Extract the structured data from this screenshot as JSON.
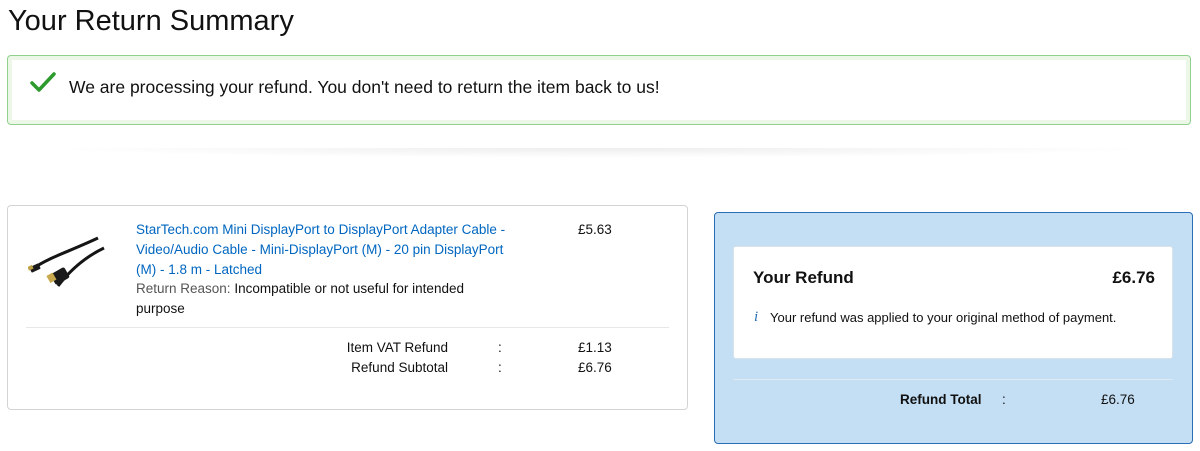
{
  "page": {
    "title": "Your Return Summary"
  },
  "alert": {
    "icon": "check-icon",
    "color": "#2c9a2c",
    "message": "We are processing your refund. You don't need to return the item back to us!"
  },
  "item": {
    "image_icon": "displayport-cable-image",
    "name": "StarTech.com Mini DisplayPort to DisplayPort Adapter Cable - Video/Audio Cable - Mini-DisplayPort (M) - 20 pin DisplayPort (M) - 1.8 m - Latched",
    "price": "£5.63",
    "return_reason_label": "Return Reason:",
    "return_reason_value": "Incompatible or not useful for intended purpose",
    "summary": [
      {
        "label": "Item VAT Refund",
        "colon": ":",
        "value": "£1.13"
      },
      {
        "label": "Refund Subtotal",
        "colon": ":",
        "value": "£6.76"
      }
    ]
  },
  "refund": {
    "title": "Your Refund",
    "amount": "£6.76",
    "info_icon": "i",
    "note": "Your refund was applied to your original method of payment.",
    "total_label": "Refund Total",
    "total_colon": ":",
    "total_value": "£6.76",
    "panel_color": "#c4def3",
    "border_color": "#2a6fb5"
  }
}
